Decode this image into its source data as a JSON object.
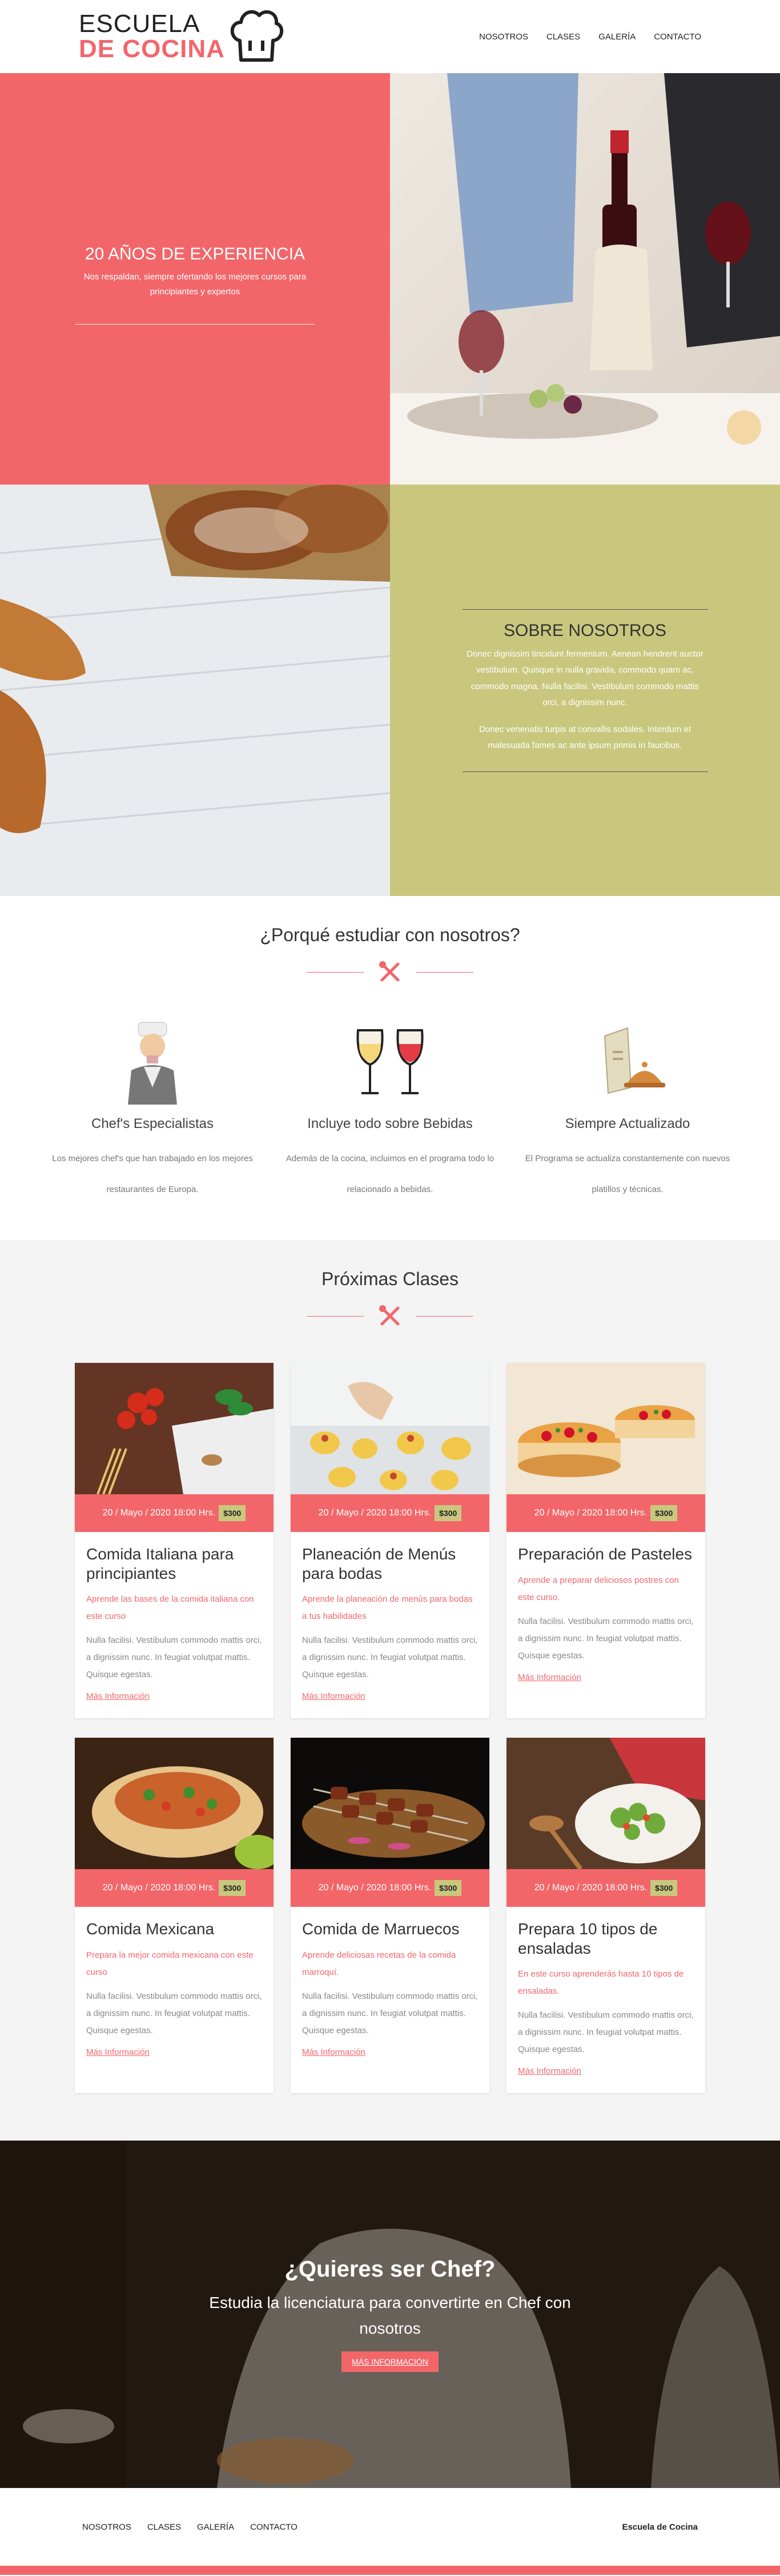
{
  "header": {
    "logo_line1": "ESCUELA",
    "logo_line2": "DE COCINA",
    "nav": [
      "NOSOTROS",
      "CLASES",
      "GALERÍA",
      "CONTACTO"
    ]
  },
  "hero": {
    "title": "20 AÑOS DE EXPERIENCIA",
    "text": "Nos respaldan, siempre ofertando los mejores cursos para principiantes y expertos"
  },
  "about": {
    "title": "SOBRE NOSOTROS",
    "p1": "Donec dignissim tincidunt fermentum. Aenean hendrerit auctor vestibulum. Quisque in nulla gravida, commodo quam ac, commodo magna. Nulla facilisi. Vestibulum commodo mattis orci, a dignissim nunc.",
    "p2": "Donec venenatis turpis at convallis sodales. Interdum et malesuada fames ac ante ipsum primis in faucibus."
  },
  "why": {
    "title": "¿Porqué estudiar con nosotros?",
    "features": [
      {
        "title": "Chef's Especialistas",
        "text": "Los mejores chef's que han trabajado en los mejores restaurantes de Europa."
      },
      {
        "title": "Incluye todo sobre Bebidas",
        "text": "Además de la cocina, incluimos en el programa todo lo relacionado a bebidas."
      },
      {
        "title": "Siempre Actualizado",
        "text": "El Programa se actualiza constantemente con nuevos platillos y técnicas."
      }
    ]
  },
  "classes": {
    "title": "Próximas Clases",
    "cards": [
      {
        "date": "20 / Mayo / 2020 18:00 Hrs.",
        "price": "$300",
        "title": "Comida Italiana para principiantes",
        "sub": "Aprende las bases de la comida italiana con este curso",
        "desc": "Nulla facilisi. Vestibulum commodo mattis orci, a dignissim nunc. In feugiat volutpat mattis. Quisque egestas.",
        "more": "Más Información"
      },
      {
        "date": "20 / Mayo / 2020 18:00 Hrs.",
        "price": "$300",
        "title": "Planeación de Menús para bodas",
        "sub": "Aprende la planeación de menús para bodas a tus habilidades",
        "desc": "Nulla facilisi. Vestibulum commodo mattis orci, a dignissim nunc. In feugiat volutpat mattis. Quisque egestas.",
        "more": "Más Información"
      },
      {
        "date": "20 / Mayo / 2020 18:00 Hrs.",
        "price": "$300",
        "title": "Preparación de Pasteles",
        "sub": "Aprende a preparar deliciosos postres con este curso.",
        "desc": "Nulla facilisi. Vestibulum commodo mattis orci, a dignissim nunc. In feugiat volutpat mattis. Quisque egestas.",
        "more": "Más Información"
      },
      {
        "date": "20 / Mayo / 2020 18:00 Hrs.",
        "price": "$300",
        "title": "Comida Mexicana",
        "sub": "Prepara la mejor comida mexicana con este curso",
        "desc": "Nulla facilisi. Vestibulum commodo mattis orci, a dignissim nunc. In feugiat volutpat mattis. Quisque egestas.",
        "more": "Más Información"
      },
      {
        "date": "20 / Mayo / 2020 18:00 Hrs.",
        "price": "$300",
        "title": "Comida de Marruecos",
        "sub": "Aprende deliciosas recetas de la comida marroquí.",
        "desc": "Nulla facilisi. Vestibulum commodo mattis orci, a dignissim nunc. In feugiat volutpat mattis. Quisque egestas.",
        "more": "Más Información"
      },
      {
        "date": "20 / Mayo / 2020 18:00 Hrs.",
        "price": "$300",
        "title": "Prepara 10 tipos de ensaladas",
        "sub": "En este curso aprenderás hasta 10 tipos de ensaladas.",
        "desc": "Nulla facilisi. Vestibulum commodo mattis orci, a dignissim nunc. In feugiat volutpat mattis. Quisque egestas.",
        "more": "Más Información"
      }
    ]
  },
  "cta": {
    "title": "¿Quieres ser Chef?",
    "text": "Estudia la licenciatura para convertirte en Chef con nosotros",
    "button": "MÁS INFORMACIÓN"
  },
  "footer": {
    "nav": [
      "NOSOTROS",
      "CLASES",
      "GALERÍA",
      "CONTACTO"
    ],
    "brand": "Escuela de Cocina"
  },
  "colors": {
    "accent": "#f2666a",
    "olive": "#c9c77d"
  }
}
